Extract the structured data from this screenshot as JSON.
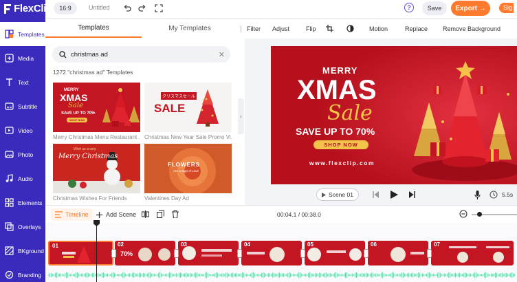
{
  "app": {
    "logo": "FlexClip"
  },
  "sidebar": {
    "items": [
      {
        "label": "Templates",
        "icon": "templates-icon",
        "active": true
      },
      {
        "label": "Media",
        "icon": "media-icon"
      },
      {
        "label": "Text",
        "icon": "text-icon"
      },
      {
        "label": "Subtitle",
        "icon": "subtitle-icon"
      },
      {
        "label": "Video",
        "icon": "video-icon"
      },
      {
        "label": "Photo",
        "icon": "photo-icon"
      },
      {
        "label": "Audio",
        "icon": "audio-icon"
      },
      {
        "label": "Elements",
        "icon": "elements-icon"
      },
      {
        "label": "Overlays",
        "icon": "overlays-icon"
      },
      {
        "label": "BKground",
        "icon": "background-icon"
      },
      {
        "label": "Branding",
        "icon": "branding-icon"
      }
    ]
  },
  "topbar": {
    "ratio": "16:9",
    "title": "Untitled",
    "save": "Save",
    "export": "Export →",
    "signin": "Sig"
  },
  "panel": {
    "tabs": [
      "Templates",
      "My Templates"
    ],
    "search_value": "christmas ad",
    "count_text": "1272 \"christmas ad\" Templates",
    "templates": [
      {
        "caption": "Merry Christmas Menu Restaurant ...",
        "title_a": "MERRY",
        "title_b": "XMAS",
        "title_c": "Sale",
        "sub": "SAVE UP TO 70%",
        "btn": "SHOP NOW"
      },
      {
        "caption": "Christmas New Year Sale Promo Vi...",
        "jp": "クリスマスセール",
        "sale": "SALE"
      },
      {
        "caption": "Christmas Wishes For Friends",
        "wish": "Wish us a very",
        "title": "Merry Christmas"
      },
      {
        "caption": "Valentines Day Ad",
        "title": "FLOWERS",
        "sub": "Are a Sign of Love"
      }
    ]
  },
  "edit_tools": [
    "Filter",
    "Adjust",
    "Flip",
    "Motion",
    "Replace",
    "Remove Background"
  ],
  "canvas": {
    "merry": "MERRY",
    "xmas": "XMAS",
    "sale": "Sale",
    "save": "SAVE UP TO 70%",
    "shop": "SHOP NOW",
    "url": "www.flexclip.com"
  },
  "player": {
    "scene": "Scene 01",
    "speed": "5.5s"
  },
  "timeline": {
    "timeline_label": "Timeline",
    "add_scene": "Add Scene",
    "time": "00:04.1 / 00:38.0",
    "clips": [
      "01",
      "02",
      "03",
      "04",
      "05",
      "06",
      "07"
    ]
  },
  "colors": {
    "brand": "#3b2bbd",
    "accent": "#ff7a2e",
    "red": "#c41522",
    "gold": "#f2c24a"
  }
}
